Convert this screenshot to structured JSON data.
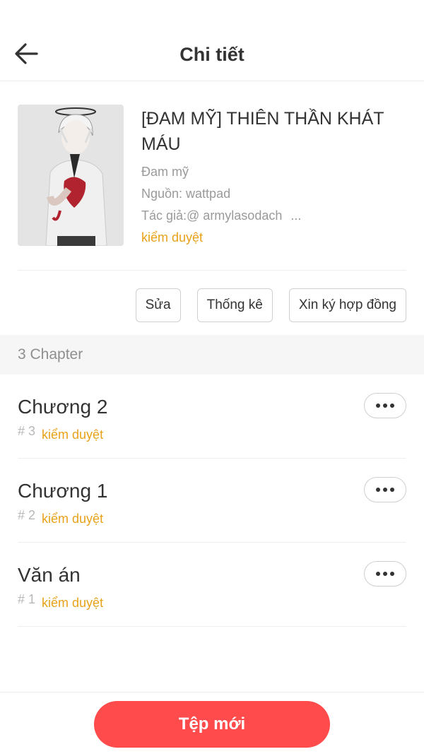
{
  "header": {
    "title": "Chi tiết"
  },
  "book": {
    "title": "[ĐAM MỸ] THIÊN THẦN KHÁT MÁU",
    "genre": "Đam mỹ",
    "source": "Nguồn: wattpad",
    "author": "Tác giả:@ armylasodach",
    "author_more": "...",
    "status": "kiểm duyệt"
  },
  "actions": {
    "edit": "Sửa",
    "stats": "Thống kê",
    "contract": "Xin ký hợp đồng"
  },
  "chapters_section": {
    "label": "3 Chapter"
  },
  "chapters": [
    {
      "title": "Chương 2",
      "number": "# 3",
      "status": "kiểm duyệt"
    },
    {
      "title": "Chương 1",
      "number": "# 2",
      "status": "kiểm duyệt"
    },
    {
      "title": "Văn án",
      "number": "# 1",
      "status": "kiểm duyệt"
    }
  ],
  "footer": {
    "new_button": "Tệp mới"
  },
  "colors": {
    "accent": "#ff4b4b",
    "status": "#e8a21a",
    "muted": "#9a9a9a"
  },
  "icons": {
    "back": "arrow-left-icon",
    "more": "more-horizontal-icon"
  }
}
